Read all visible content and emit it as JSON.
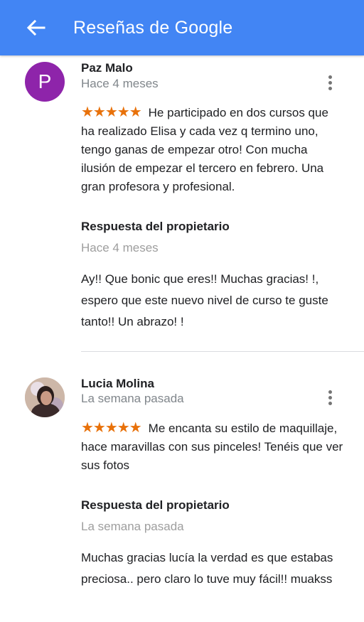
{
  "appbar": {
    "title": "Reseñas de Google",
    "color": "#4285f4"
  },
  "reviews": [
    {
      "author": "Paz Malo",
      "avatar_letter": "P",
      "avatar_color": "#8e24aa",
      "time": "Hace 4 meses",
      "rating": 5,
      "stars": "★★★★★",
      "text": "He participado en dos cursos que ha realizado Elisa y cada vez q termino uno, tengo ganas de empezar otro! Con mucha ilusión de empezar el tercero en febrero. Una gran profesora y profesional.",
      "reply": {
        "label": "Respuesta del propietario",
        "time": "Hace 4 meses",
        "text": "Ay!! Que bonic que eres!! Muchas gracias! !, espero que este nuevo nivel de curso te guste tanto!! Un abrazo! !"
      }
    },
    {
      "author": "Lucia Molina",
      "avatar_icon": "profile-photo",
      "time": "La semana pasada",
      "rating": 5,
      "stars": "★★★★★",
      "text": "Me encanta su estilo de maquillaje, hace maravillas con sus pinceles! Tenéis que ver sus fotos",
      "reply": {
        "label": "Respuesta del propietario",
        "time": "La semana pasada",
        "text": "Muchas gracias lucía la verdad es que estabas preciosa.. pero claro lo tuve muy fácil!! muakss"
      }
    }
  ],
  "colors": {
    "star": "#e8710a",
    "divider": "#dadce0"
  }
}
